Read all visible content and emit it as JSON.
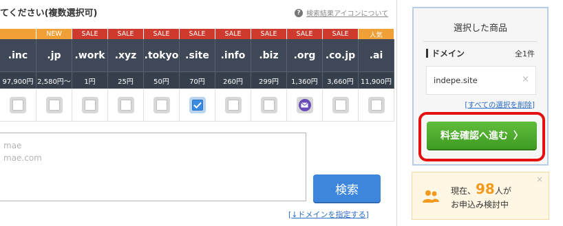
{
  "heading": "てください(複数選択可)",
  "help_link": "検索結果アイコンについて",
  "tlds": [
    {
      "badge": "",
      "badge_type": "none",
      "name": ".inc",
      "price": "97,900円",
      "state": "empty"
    },
    {
      "badge": "NEW",
      "badge_type": "new",
      "name": ".jp",
      "price": "2,580円〜",
      "state": "empty"
    },
    {
      "badge": "SALE",
      "badge_type": "sale",
      "name": ".work",
      "price": "1円",
      "state": "empty"
    },
    {
      "badge": "SALE",
      "badge_type": "sale",
      "name": ".xyz",
      "price": "25円",
      "state": "empty"
    },
    {
      "badge": "SALE",
      "badge_type": "sale",
      "name": ".tokyo",
      "price": "50円",
      "state": "empty"
    },
    {
      "badge": "SALE",
      "badge_type": "sale",
      "name": ".site",
      "price": "70円",
      "state": "checked"
    },
    {
      "badge": "SALE",
      "badge_type": "sale",
      "name": ".info",
      "price": "260円",
      "state": "empty"
    },
    {
      "badge": "SALE",
      "badge_type": "sale",
      "name": ".biz",
      "price": "299円",
      "state": "empty"
    },
    {
      "badge": "SALE",
      "badge_type": "sale",
      "name": ".org",
      "price": "1,360円",
      "state": "mail"
    },
    {
      "badge": "SALE",
      "badge_type": "sale",
      "name": ".co.jp",
      "price": "3,660円",
      "state": "empty"
    },
    {
      "badge": "人気",
      "badge_type": "pop",
      "name": ".ai",
      "price": "11,900円",
      "state": "empty"
    }
  ],
  "domain_input": {
    "placeholder_line1": "mae",
    "placeholder_line2": "mae.com"
  },
  "search_button": "検索",
  "specify_link_open": "[",
  "specify_link": "↓ドメインを指定する",
  "specify_link_close": "]",
  "panel": {
    "title": "選択した商品",
    "domain_label": "ドメイン",
    "count": "全1件",
    "selected_domain": "indepe.site",
    "remove_icon": "×",
    "clear_open": "[",
    "clear_all": "すべての選択を削除",
    "clear_close": "]",
    "confirm_button": "料金確認へ進む",
    "confirm_chevron": "〉"
  },
  "notice": {
    "prefix": "現在、",
    "number": "98",
    "suffix": "人が",
    "line2": "お申込み検討中",
    "close": "×"
  },
  "colors": {
    "sale": "#cf3a2f",
    "new": "#f0a036",
    "header_bg": "#3f4857",
    "confirm_green": "#4cae2c",
    "search_blue": "#3d86dc",
    "highlight_red": "#e60f0f",
    "notice_orange": "#f29a1e"
  }
}
